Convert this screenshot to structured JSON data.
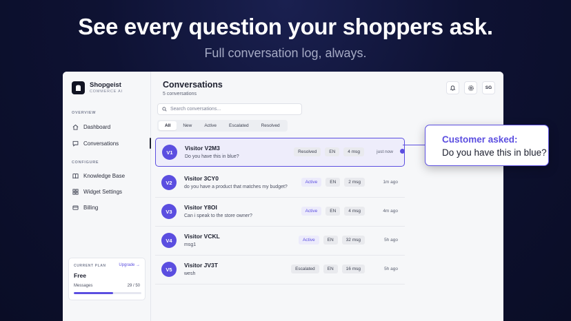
{
  "hero": {
    "title": "See every question your shoppers ask.",
    "subtitle": "Full conversation log, always."
  },
  "brand": {
    "name": "Shopgeist",
    "tagline": "COMMERCE AI"
  },
  "sidebar": {
    "overview_label": "OVERVIEW",
    "configure_label": "CONFIGURE",
    "items": [
      {
        "label": "Dashboard",
        "icon": "home-icon"
      },
      {
        "label": "Conversations",
        "icon": "chat-icon",
        "active": true
      },
      {
        "label": "Knowledge Base",
        "icon": "book-icon"
      },
      {
        "label": "Widget Settings",
        "icon": "grid-icon"
      },
      {
        "label": "Billing",
        "icon": "card-icon"
      }
    ],
    "plan": {
      "label": "CURRENT PLAN",
      "upgrade": "Upgrade →",
      "name": "Free",
      "messages_label": "Messages",
      "messages_count": "29 / 50",
      "usage_fraction": 0.58
    }
  },
  "main": {
    "title": "Conversations",
    "count": "5 conversations",
    "user_initials": "SG",
    "search_placeholder": "Search conversations...",
    "filters": [
      "All",
      "New",
      "Active",
      "Escalated",
      "Resolved"
    ],
    "active_filter": "All",
    "conversations": [
      {
        "initials": "V1",
        "name": "Visitor V2M3",
        "message": "Do you have this in blue?",
        "status": "Resolved",
        "lang": "EN",
        "msgs": "4 msg",
        "time": "just now",
        "selected": true
      },
      {
        "initials": "V2",
        "name": "Visitor 3CY0",
        "message": "do you have a product that matches my budget?",
        "status": "Active",
        "lang": "EN",
        "msgs": "2 msg",
        "time": "1m ago"
      },
      {
        "initials": "V3",
        "name": "Visitor Y8OI",
        "message": "Can i speak to the store owner?",
        "status": "Active",
        "lang": "EN",
        "msgs": "4 msg",
        "time": "4m ago"
      },
      {
        "initials": "V4",
        "name": "Visitor VCKL",
        "message": "msg1",
        "status": "Active",
        "lang": "EN",
        "msgs": "32 msg",
        "time": "5h ago"
      },
      {
        "initials": "V5",
        "name": "Visitor JV3T",
        "message": "wesh",
        "status": "Escalated",
        "lang": "EN",
        "msgs": "16 msg",
        "time": "5h ago"
      }
    ]
  },
  "callout": {
    "title": "Customer asked:",
    "text": "Do you have this in blue?"
  },
  "colors": {
    "accent": "#5b4ee0",
    "background": "#0e1233"
  }
}
